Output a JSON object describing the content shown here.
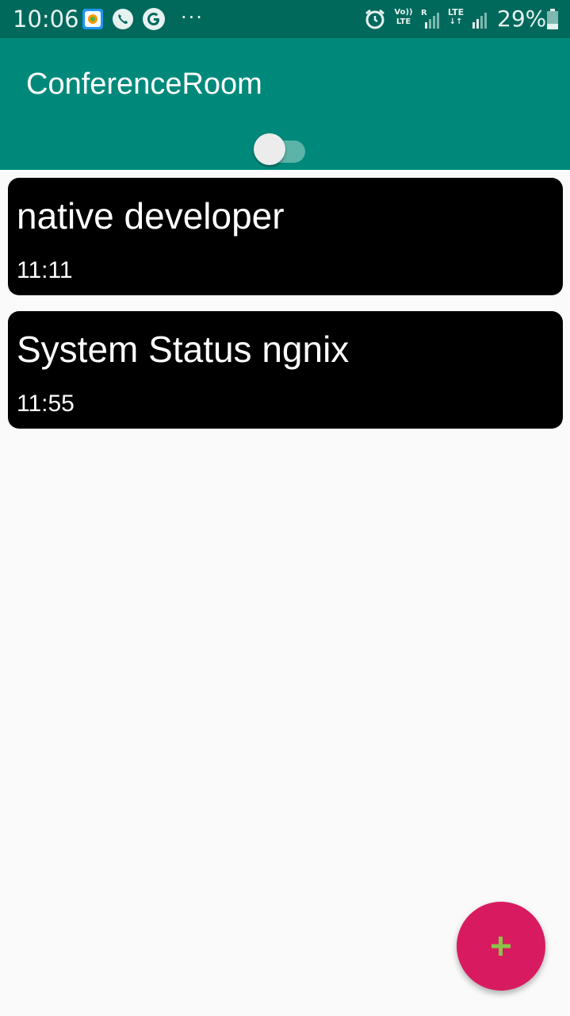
{
  "status_bar": {
    "time": "10:06",
    "more_indicator": "···",
    "volte_top": "Vo))",
    "volte_bottom": "LTE",
    "roaming": "R",
    "lte_label": "LTE",
    "battery": "29%",
    "icons": [
      "photos-app-icon",
      "phone-call-icon",
      "google-icon",
      "alarm-icon",
      "volte-icon",
      "signal-icon",
      "lte-icon",
      "signal-icon",
      "battery-icon"
    ]
  },
  "app_bar": {
    "title": "ConferenceRoom",
    "toggle_on": false,
    "color": "#00897b"
  },
  "rooms": [
    {
      "title": "native developer",
      "time": "11:11"
    },
    {
      "title": "System Status ngnix",
      "time": "11:55"
    }
  ],
  "fab": {
    "icon": "plus-icon",
    "color": "#d81b60",
    "icon_color": "#8bc34a"
  }
}
